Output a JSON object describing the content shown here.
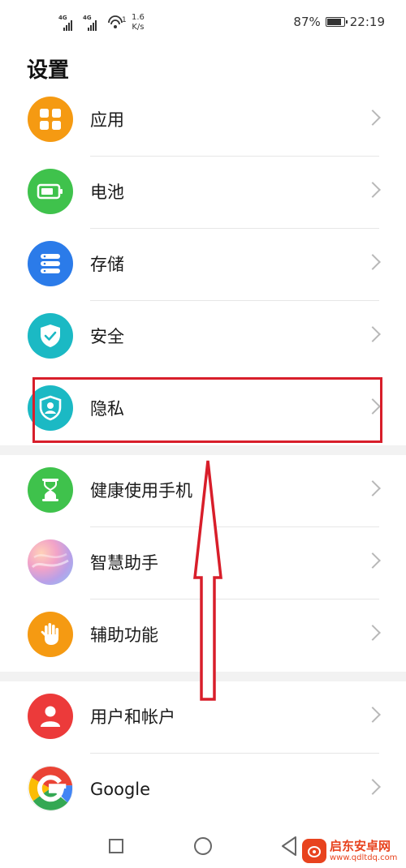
{
  "status_bar": {
    "sim1_network": "4G",
    "sim2_network": "4G",
    "wifi_badge": "1",
    "speed_value": "1.6",
    "speed_unit": "K/s",
    "battery_text": "87%",
    "battery_level": 0.87,
    "time": "22:19"
  },
  "page": {
    "title": "设置"
  },
  "settings_items": [
    {
      "label": "应用",
      "icon": "apps-grid-icon",
      "color": "#f59a12"
    },
    {
      "label": "电池",
      "icon": "battery-icon",
      "color": "#3fc24c"
    },
    {
      "label": "存储",
      "icon": "storage-icon",
      "color": "#2b7be9"
    },
    {
      "label": "安全",
      "icon": "shield-check-icon",
      "color": "#1bb9c4"
    },
    {
      "label": "隐私",
      "icon": "privacy-shield-icon",
      "color": "#1bb9c4"
    },
    {
      "label": "健康使用手机",
      "icon": "hourglass-icon",
      "color": "#3fc24c"
    },
    {
      "label": "智慧助手",
      "icon": "assistant-orb-icon",
      "color": "#b8a0e8"
    },
    {
      "label": "辅助功能",
      "icon": "hand-icon",
      "color": "#f59a12"
    },
    {
      "label": "用户和帐户",
      "icon": "user-icon",
      "color": "#ec3a3a"
    },
    {
      "label": "Google",
      "icon": "google-g-icon",
      "color": "#ffffff"
    }
  ],
  "annotation": {
    "highlight_color": "#d81e2a"
  },
  "watermark": {
    "title": "启东安卓网",
    "url": "www.qdltdq.com"
  }
}
